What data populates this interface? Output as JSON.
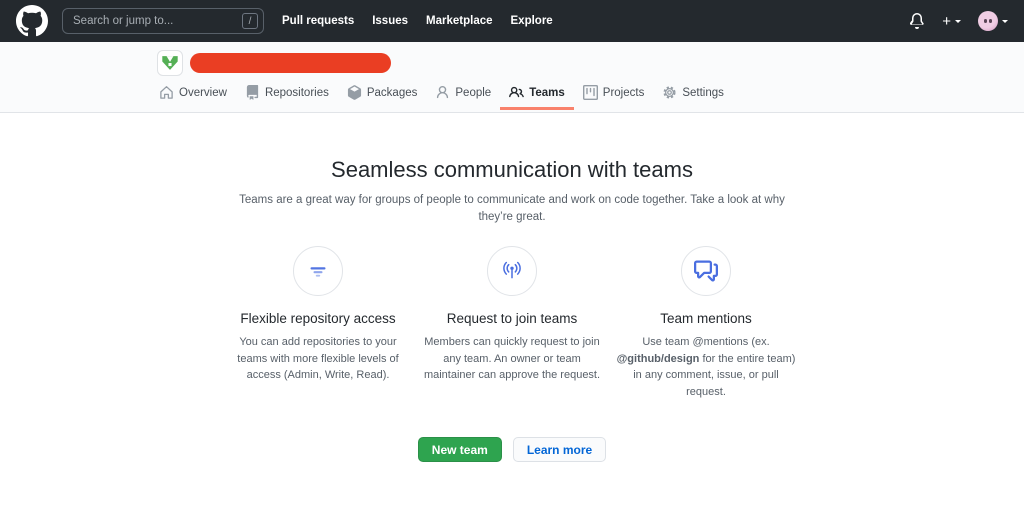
{
  "navbar": {
    "search": {
      "placeholder": "Search or jump to...",
      "shortcut_key": "/"
    },
    "links": [
      {
        "label": "Pull requests"
      },
      {
        "label": "Issues"
      },
      {
        "label": "Marketplace"
      },
      {
        "label": "Explore"
      }
    ]
  },
  "org_header": {
    "tabs": [
      {
        "label": "Overview",
        "icon": "home-icon",
        "selected": false
      },
      {
        "label": "Repositories",
        "icon": "repo-icon",
        "selected": false
      },
      {
        "label": "Packages",
        "icon": "package-icon",
        "selected": false
      },
      {
        "label": "People",
        "icon": "person-icon",
        "selected": false
      },
      {
        "label": "Teams",
        "icon": "people-icon",
        "selected": true
      },
      {
        "label": "Projects",
        "icon": "project-icon",
        "selected": false
      },
      {
        "label": "Settings",
        "icon": "gear-icon",
        "selected": false
      }
    ]
  },
  "main": {
    "title": "Seamless communication with teams",
    "subtitle": "Teams are a great way for groups of people to communicate and work on code together. Take a look at why they’re great.",
    "features": [
      {
        "icon": "filter-lines-icon",
        "title": "Flexible repository access",
        "description": "You can add repositories to your teams with more flexible levels of access (Admin, Write, Read)."
      },
      {
        "icon": "broadcast-icon",
        "title": "Request to join teams",
        "description": "Members can quickly request to join any team. An owner or team maintainer can approve the request."
      },
      {
        "icon": "comment-discussion-icon",
        "title": "Team mentions",
        "description_prefix": "Use team @mentions (ex. ",
        "description_bold": "@github/design",
        "description_suffix": " for the entire team) in any comment, issue, or pull request."
      }
    ],
    "buttons": {
      "new_team": "New team",
      "learn_more": "Learn more"
    }
  },
  "colors": {
    "navbar_bg": "#24292e",
    "org_header_bg": "#fafbfc",
    "selected_tab_underline": "#f9826c",
    "redaction_pill": "#ea3e23",
    "identicon_green": "#55af55",
    "feature_icon_blue": "#4a6ee0",
    "new_team_green": "#2ea44f",
    "learn_more_blue": "#0366d6"
  }
}
